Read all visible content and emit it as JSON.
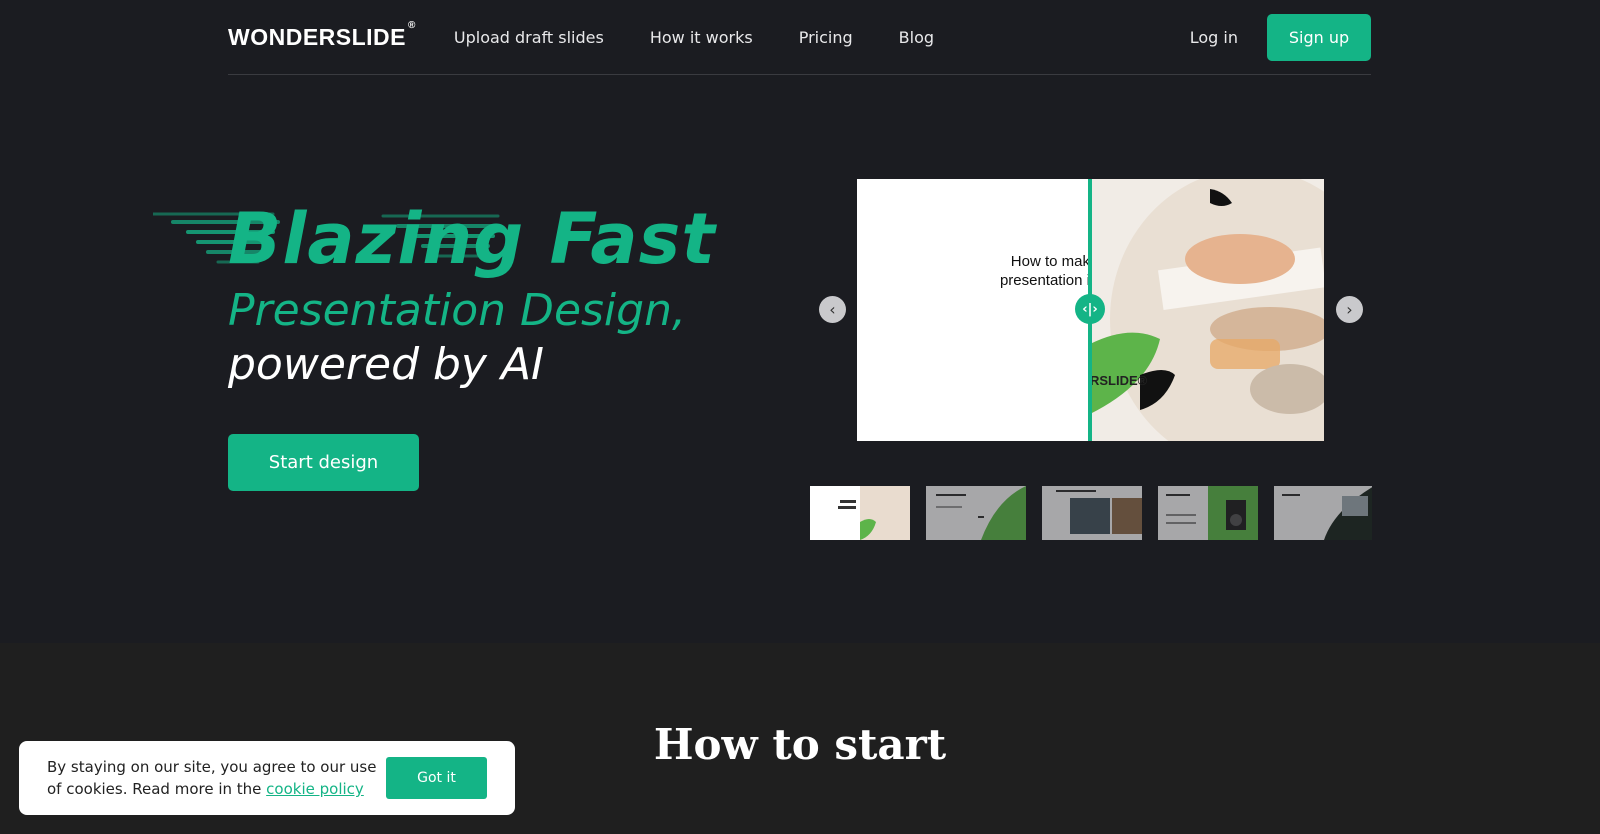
{
  "brand": {
    "name": "WONDERSLIDE",
    "mark": "®"
  },
  "nav": {
    "links": [
      "Upload draft slides",
      "How it works",
      "Pricing",
      "Blog"
    ],
    "login": "Log in",
    "signup": "Sign up"
  },
  "hero": {
    "headline_word1": "Blazing",
    "headline_word2": "Fast",
    "subline1": "Presentation Design,",
    "subline2": "powered by AI",
    "cta": "Start design"
  },
  "preview": {
    "slide_title_line1": "How to mak",
    "slide_title_line2": "presentation i",
    "slide_brand": "RSLIDE®",
    "prev_arrow": "‹",
    "next_arrow": "›",
    "handle_icon": "‹|›",
    "thumbnail_count": 5
  },
  "section": {
    "title": "How to start"
  },
  "cookie": {
    "text": "By staying on our site, you agree to our use of cookies. Read more in the ",
    "link": "cookie policy",
    "button": "Got it"
  },
  "colors": {
    "accent": "#14b486",
    "background": "#1b1c21",
    "section": "#1f1f1f"
  }
}
